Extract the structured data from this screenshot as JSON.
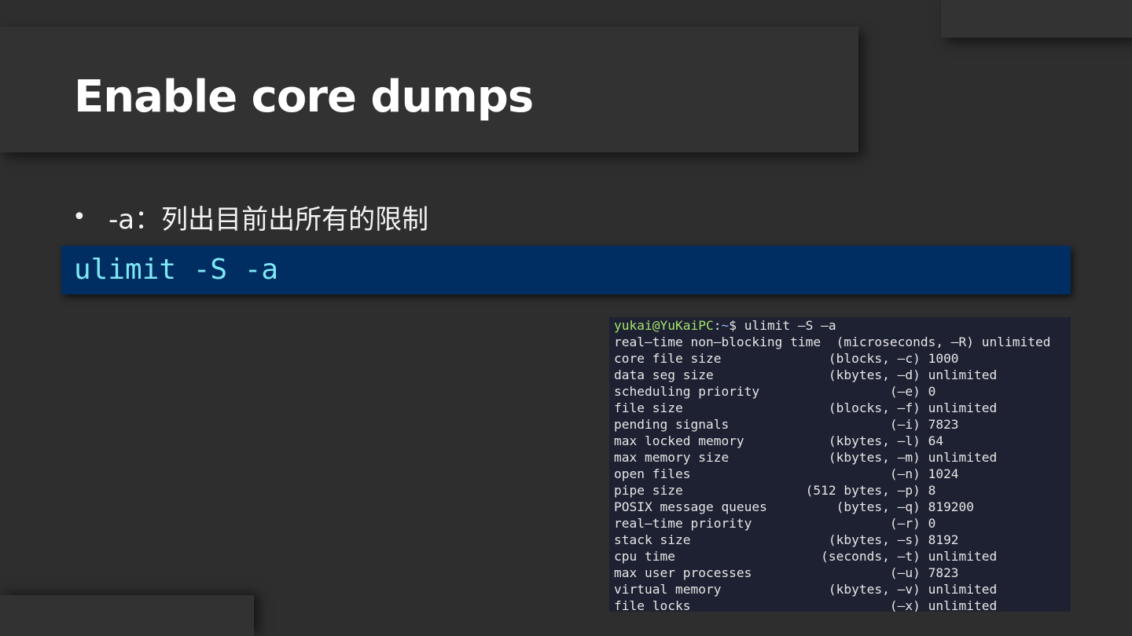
{
  "slide": {
    "title": "Enable core dumps",
    "bullet_symbol": "•",
    "bullet_text": "-a：列出目前出所有的限制",
    "command": "ulimit -S -a"
  },
  "terminal": {
    "prompt_user_host": "yukai@YuKaiPC",
    "prompt_separator": ":",
    "prompt_path": "~",
    "prompt_symbol": "$ ",
    "prompt_command": "ulimit –S –a",
    "lines": [
      "real–time non–blocking time  (microseconds, –R) unlimited",
      "core file size              (blocks, –c) 1000",
      "data seg size               (kbytes, –d) unlimited",
      "scheduling priority                 (–e) 0",
      "file size                   (blocks, –f) unlimited",
      "pending signals                     (–i) 7823",
      "max locked memory           (kbytes, –l) 64",
      "max memory size             (kbytes, –m) unlimited",
      "open files                          (–n) 1024",
      "pipe size                (512 bytes, –p) 8",
      "POSIX message queues         (bytes, –q) 819200",
      "real–time priority                  (–r) 0",
      "stack size                  (kbytes, –s) 8192",
      "cpu time                   (seconds, –t) unlimited",
      "max user processes                  (–u) 7823",
      "virtual memory              (kbytes, –v) unlimited",
      "file locks                          (–x) unlimited"
    ]
  },
  "colors": {
    "background": "#2e2e2e",
    "command_box": "#002d62",
    "command_text": "#7ee8f5",
    "terminal_bg": "#1e2132",
    "prompt_user": "#a5e36b",
    "prompt_path": "#8fb6ff"
  }
}
